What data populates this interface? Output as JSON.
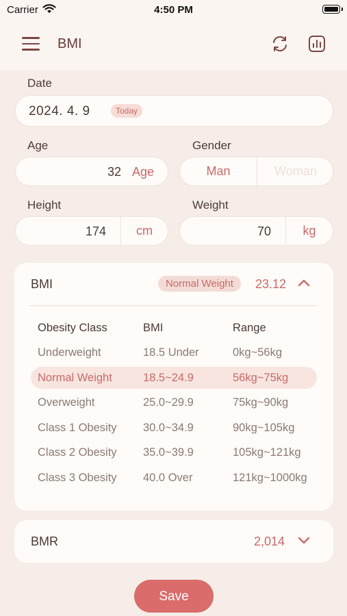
{
  "status_bar": {
    "carrier": "Carrier",
    "time": "4:50 PM"
  },
  "header": {
    "title": "BMI",
    "icons": [
      "menu-icon",
      "refresh-icon",
      "chart-icon"
    ]
  },
  "form": {
    "date": {
      "label": "Date",
      "value": "2024. 4. 9",
      "badge": "Today"
    },
    "age": {
      "label": "Age",
      "value": "32",
      "unit": "Age"
    },
    "gender": {
      "label": "Gender",
      "options": [
        "Man",
        "Woman"
      ],
      "selected": "Man"
    },
    "height": {
      "label": "Height",
      "value": "174",
      "unit": "cm"
    },
    "weight": {
      "label": "Weight",
      "value": "70",
      "unit": "kg"
    }
  },
  "bmi_card": {
    "title": "BMI",
    "status_badge": "Normal Weight",
    "value": "23.12",
    "expanded": true,
    "table": {
      "headers": [
        "Obesity Class",
        "BMI",
        "Range"
      ],
      "rows": [
        [
          "Underweight",
          "18.5 Under",
          "0kg~56kg"
        ],
        [
          "Normal Weight",
          "18.5~24.9",
          "56kg~75kg"
        ],
        [
          "Overweight",
          "25.0~29.9",
          "75kg~90kg"
        ],
        [
          "Class 1 Obesity",
          "30.0~34.9",
          "90kg~105kg"
        ],
        [
          "Class 2 Obesity",
          "35.0~39.9",
          "105kg~121kg"
        ],
        [
          "Class 3 Obesity",
          "40.0 Over",
          "121kg~1000kg"
        ]
      ],
      "highlighted_row": 1
    }
  },
  "bmr_card": {
    "title": "BMR",
    "value": "2,014",
    "expanded": false
  },
  "save_button": {
    "label": "Save"
  },
  "colors": {
    "accent": "#da6c6c",
    "accent_text": "#c96a6a",
    "background": "#f6ede8",
    "card": "#fffbf8"
  }
}
